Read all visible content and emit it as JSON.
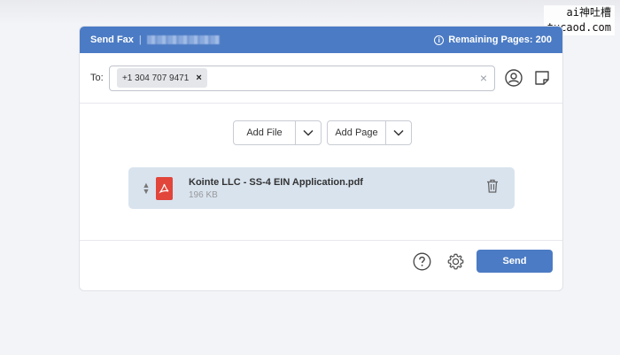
{
  "watermark": {
    "line1": "ai神吐槽",
    "line2": "tucaod.com"
  },
  "header": {
    "title": "Send Fax",
    "separator": "|",
    "remaining_label": "Remaining Pages: 200"
  },
  "recipients": {
    "label": "To:",
    "chips": [
      {
        "number": "+1 304 707 9471",
        "remove": "×"
      }
    ],
    "clear": "×"
  },
  "actions": {
    "add_file": "Add File",
    "add_page": "Add Page"
  },
  "file": {
    "name": "Kointe LLC - SS-4 EIN Application.pdf",
    "size": "196 KB"
  },
  "footer": {
    "send": "Send"
  },
  "colors": {
    "accent": "#4b7bc4",
    "pdf": "#e2453a",
    "file_card": "#d8e3ee"
  }
}
